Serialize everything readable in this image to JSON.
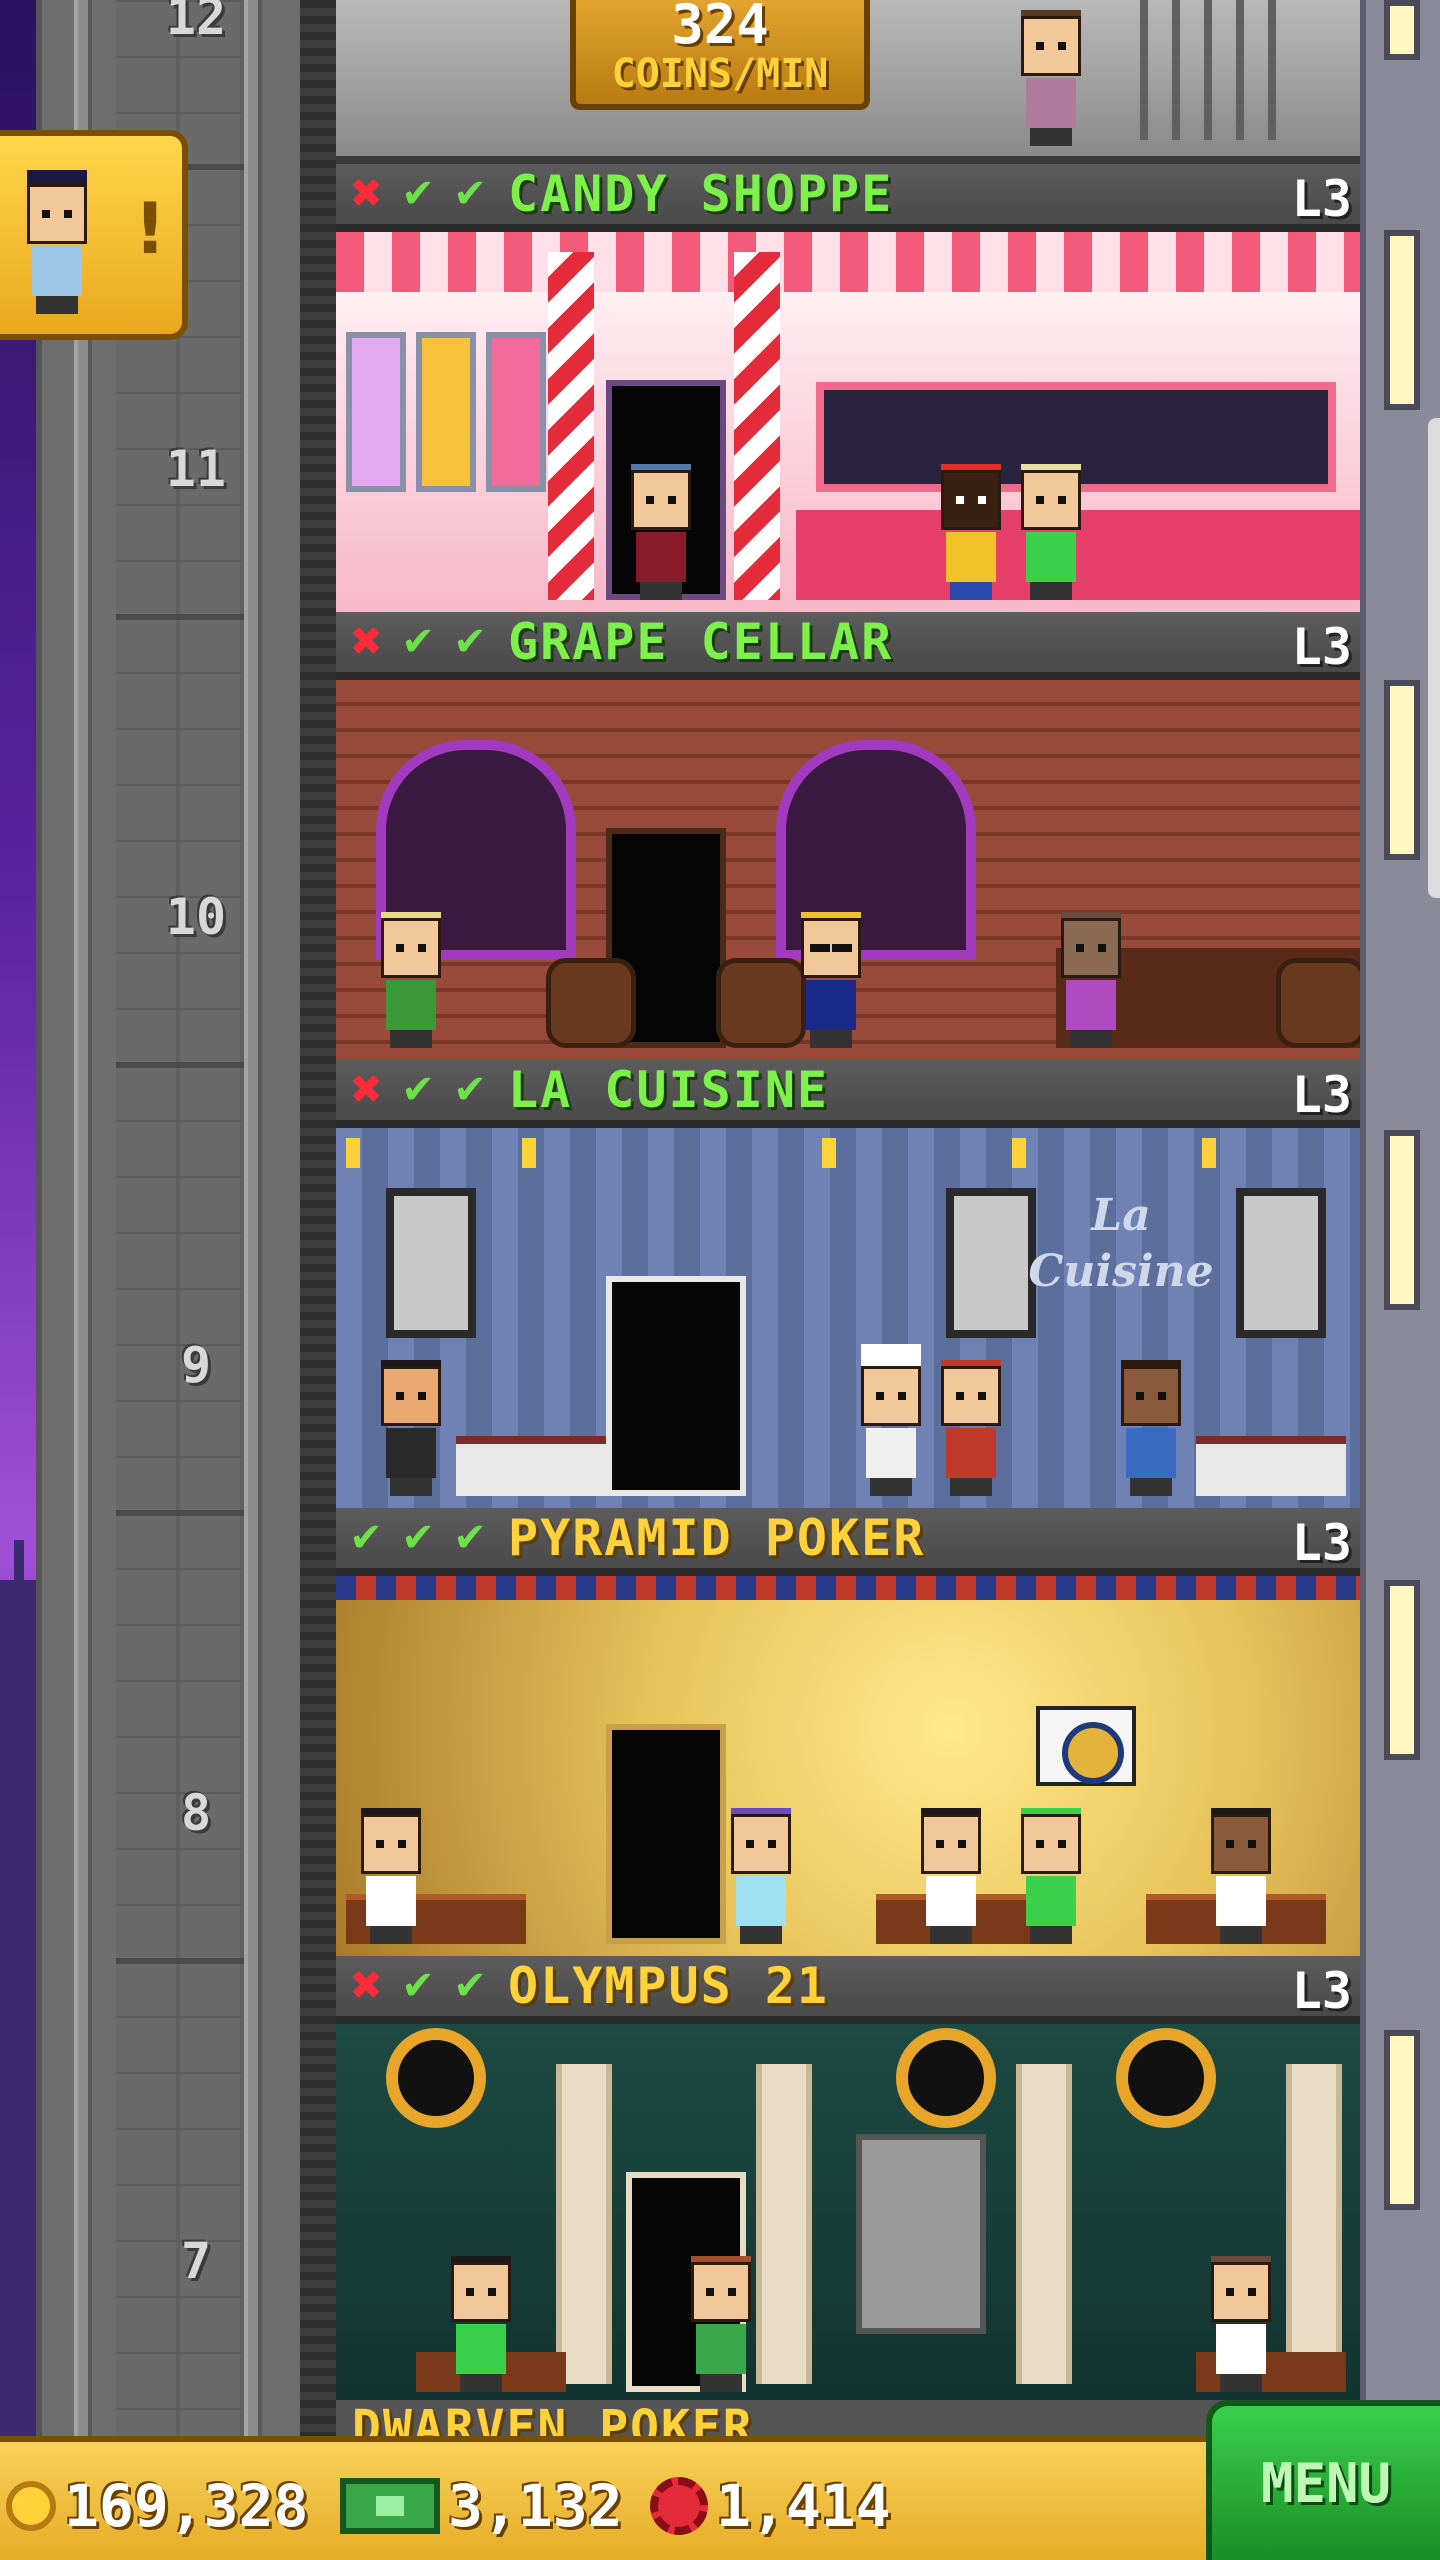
{
  "top_floor": {
    "number": "12",
    "coins_rate_value": "324",
    "coins_rate_label": "COINS/MIN"
  },
  "floors": [
    {
      "number": "11",
      "name": "CANDY SHOPPE",
      "level": "L3",
      "name_color": "green",
      "checks": [
        "x",
        "check",
        "check"
      ]
    },
    {
      "number": "10",
      "name": "GRAPE CELLAR",
      "level": "L3",
      "name_color": "green",
      "checks": [
        "x",
        "check",
        "check"
      ]
    },
    {
      "number": "9",
      "name": "LA CUISINE",
      "level": "L3",
      "name_color": "green",
      "checks": [
        "x",
        "check",
        "check"
      ]
    },
    {
      "number": "8",
      "name": "PYRAMID POKER",
      "level": "L3",
      "name_color": "gold",
      "checks": [
        "check",
        "check",
        "check"
      ]
    },
    {
      "number": "7",
      "name": "OLYMPUS 21",
      "level": "L3",
      "name_color": "gold",
      "checks": [
        "x",
        "check",
        "check"
      ]
    }
  ],
  "partial_floor": {
    "name": "DWARVEN POKER"
  },
  "cuisine_logo": "La Cuisine",
  "bottom_bar": {
    "coins": "169,328",
    "bux": "3,132",
    "chips": "1,414",
    "menu_label": "MENU"
  },
  "icons": {
    "coin": "coin-icon",
    "bux": "tower-bux-icon",
    "chip": "poker-chip-icon",
    "vip": "vip-visitor-icon",
    "x": "x-mark-icon",
    "check": "check-mark-icon"
  },
  "colors": {
    "name_green": "#7ef04a",
    "name_gold": "#ffd23a",
    "bar_gold": "#e6ac26",
    "menu_green": "#1a8e28"
  }
}
